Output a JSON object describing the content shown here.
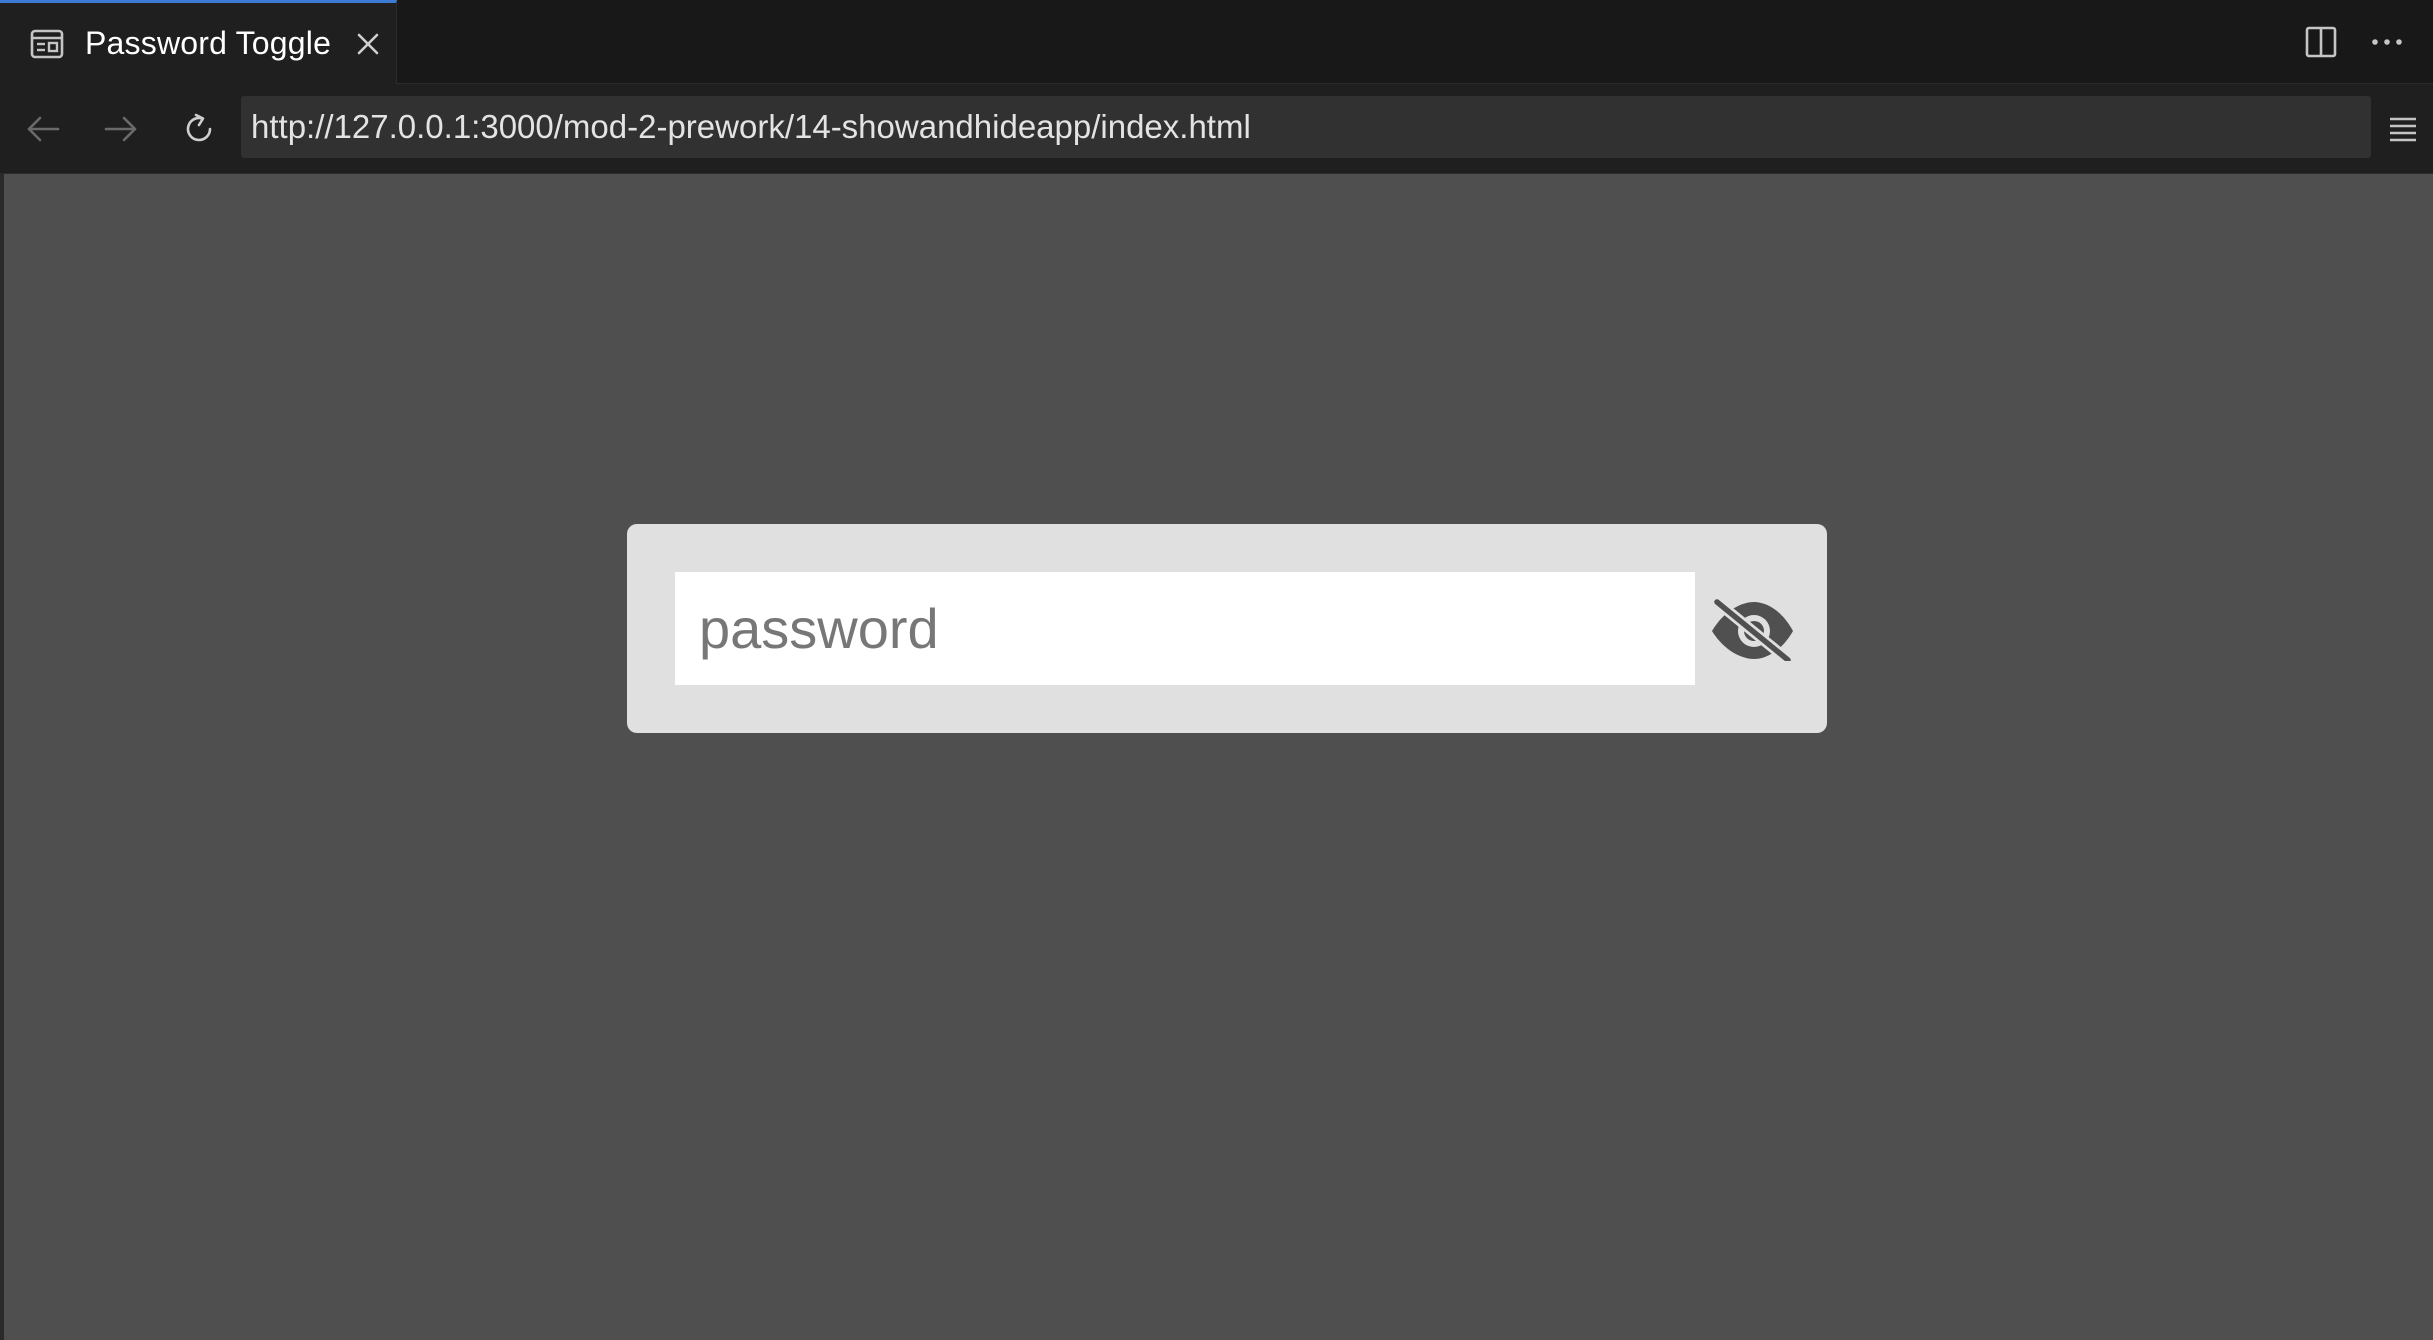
{
  "tab": {
    "title": "Password Toggle",
    "icon": "preview-icon",
    "close_icon": "close-icon"
  },
  "tabbar_actions": [
    {
      "name": "split-editor-icon"
    },
    {
      "name": "more-actions-icon"
    }
  ],
  "navigation": {
    "back_icon": "arrow-left-icon",
    "forward_icon": "arrow-right-icon",
    "reload_icon": "refresh-icon",
    "url": "http://127.0.0.1:3000/mod-2-prework/14-showandhideapp/index.html",
    "menu_icon": "hamburger-menu-icon"
  },
  "page": {
    "password_placeholder": "password",
    "password_value": "",
    "toggle_icon": "eye-slash-icon"
  },
  "colors": {
    "viewport_bg": "#4f4f4f",
    "card_bg": "#e0e0e0",
    "input_bg": "#ffffff",
    "icon": "#505050",
    "tab_accent": "#3c7ad6"
  }
}
